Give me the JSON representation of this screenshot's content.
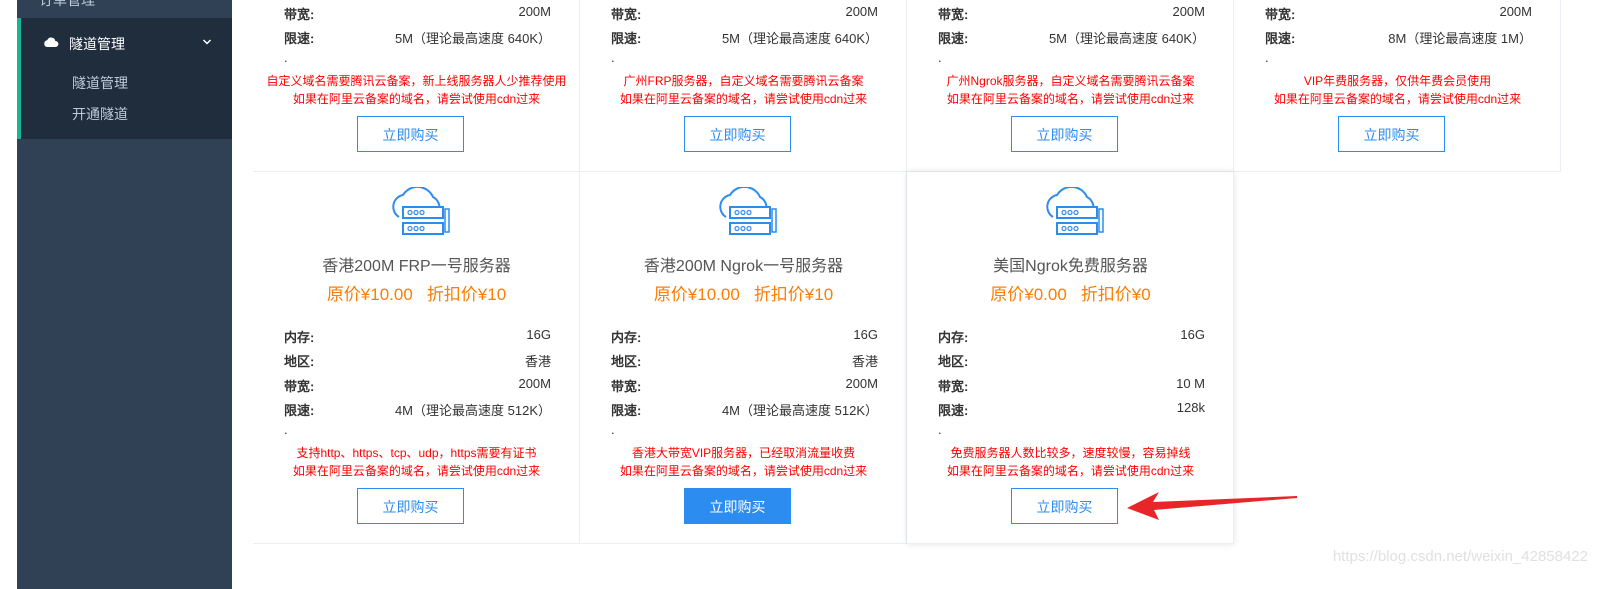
{
  "sidebar": {
    "prev_item": "订单管理",
    "group_title": "隧道管理",
    "sub_items": [
      "隧道管理",
      "开通隧道"
    ]
  },
  "top_cards": [
    {
      "specs": [
        {
          "k": "带宽:",
          "v": "200M"
        },
        {
          "k": "限速:",
          "v": "5M（理论最高速度 640K）"
        }
      ],
      "dot": ".",
      "notes": [
        "自定义域名需要腾讯云备案，新上线服务器人少推荐使用",
        "如果在阿里云备案的域名，请尝试使用cdn过来"
      ],
      "button": "立即购买"
    },
    {
      "specs": [
        {
          "k": "带宽:",
          "v": "200M"
        },
        {
          "k": "限速:",
          "v": "5M（理论最高速度 640K）"
        }
      ],
      "dot": ".",
      "notes": [
        "广州FRP服务器，自定义域名需要腾讯云备案",
        "如果在阿里云备案的域名，请尝试使用cdn过来"
      ],
      "button": "立即购买"
    },
    {
      "specs": [
        {
          "k": "带宽:",
          "v": "200M"
        },
        {
          "k": "限速:",
          "v": "5M（理论最高速度 640K）"
        }
      ],
      "dot": ".",
      "notes": [
        "广州Ngrok服务器，自定义域名需要腾讯云备案",
        "如果在阿里云备案的域名，请尝试使用cdn过来"
      ],
      "button": "立即购买"
    },
    {
      "specs": [
        {
          "k": "带宽:",
          "v": "200M"
        },
        {
          "k": "限速:",
          "v": "8M（理论最高速度 1M）"
        }
      ],
      "dot": ".",
      "notes": [
        "VIP年费服务器，仅供年费会员使用",
        "如果在阿里云备案的域名，请尝试使用cdn过来"
      ],
      "button": "立即购买"
    }
  ],
  "bottom_cards": [
    {
      "name": "香港200M FRP一号服务器",
      "orig_price": "原价¥10.00",
      "disc_price": "折扣价¥10",
      "specs": [
        {
          "k": "内存:",
          "v": "16G"
        },
        {
          "k": "地区:",
          "v": "香港"
        },
        {
          "k": "带宽:",
          "v": "200M"
        },
        {
          "k": "限速:",
          "v": "4M（理论最高速度 512K）"
        }
      ],
      "dot": ".",
      "notes": [
        "支持http、https、tcp、udp，https需要有证书",
        "如果在阿里云备案的域名，请尝试使用cdn过来"
      ],
      "button": "立即购买"
    },
    {
      "name": "香港200M Ngrok一号服务器",
      "orig_price": "原价¥10.00",
      "disc_price": "折扣价¥10",
      "specs": [
        {
          "k": "内存:",
          "v": "16G"
        },
        {
          "k": "地区:",
          "v": "香港"
        },
        {
          "k": "带宽:",
          "v": "200M"
        },
        {
          "k": "限速:",
          "v": "4M（理论最高速度 512K）"
        }
      ],
      "dot": ".",
      "notes": [
        "香港大带宽VIP服务器，已经取消流量收费",
        "如果在阿里云备案的域名，请尝试使用cdn过来"
      ],
      "button": "立即购买"
    },
    {
      "name": "美国Ngrok免费服务器",
      "orig_price": "原价¥0.00",
      "disc_price": "折扣价¥0",
      "specs": [
        {
          "k": "内存:",
          "v": "16G"
        },
        {
          "k": "地区:",
          "v": ""
        },
        {
          "k": "带宽:",
          "v": "10 M"
        },
        {
          "k": "限速:",
          "v": "128k"
        }
      ],
      "dot": ".",
      "notes": [
        "免费服务器人数比较多，速度较慢，容易掉线",
        "如果在阿里云备案的域名，请尝试使用cdn过来"
      ],
      "button": "立即购买"
    }
  ],
  "watermark": "https://blog.csdn.net/weixin_42858422",
  "colors": {
    "sidebar_bg": "#304156",
    "accent": "#2d8cf0",
    "price": "#ff7d00",
    "note": "#ff0000",
    "arrow": "#e8262a"
  }
}
